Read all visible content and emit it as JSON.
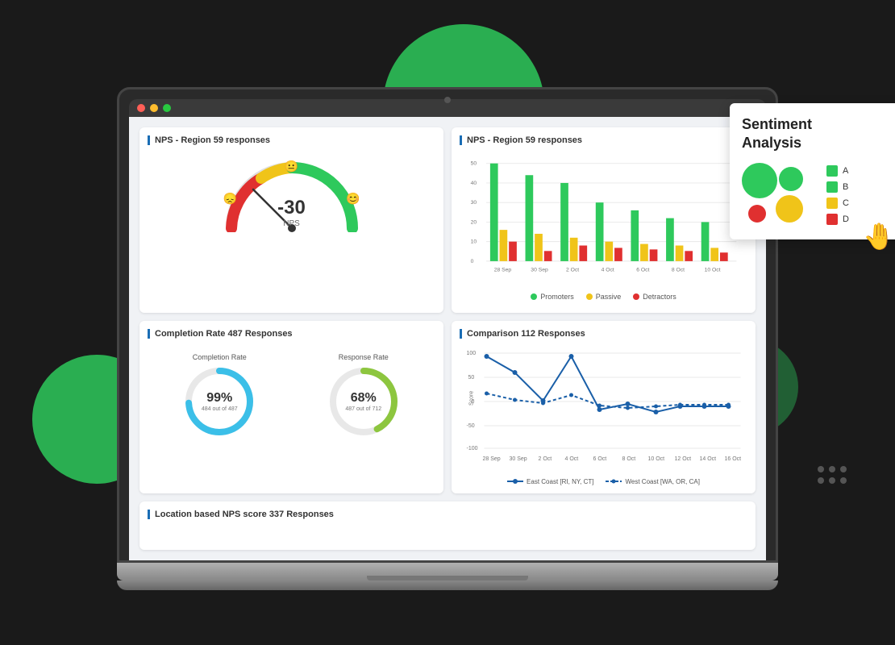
{
  "background": {
    "color": "#1a1a1a"
  },
  "sentiment_card": {
    "title": "Sentiment\nAnalysis",
    "legend": [
      {
        "label": "A",
        "color": "#2ec95c"
      },
      {
        "label": "B",
        "color": "#2ec95c"
      },
      {
        "label": "C",
        "color": "#f0c419"
      },
      {
        "label": "D",
        "color": "#e03030"
      }
    ]
  },
  "nps_gauge": {
    "card_title": "NPS - Region 59 responses",
    "value": "-30",
    "label": "NPS"
  },
  "bar_chart": {
    "card_title": "NPS - Region 59 responses",
    "legend": {
      "promoters": "Promoters",
      "passive": "Passive",
      "detractors": "Detractors"
    },
    "dates": [
      "28 Sep",
      "30 Sep",
      "2 Oct",
      "4 Oct",
      "6 Oct",
      "8 Oct",
      "10 Oct"
    ]
  },
  "completion": {
    "card_title": "Completion Rate 487 Responses",
    "completion": {
      "title": "Completion Rate",
      "percent": "99%",
      "sub": "484 out of 487",
      "color": "#3bbfe8"
    },
    "response": {
      "title": "Response Rate",
      "percent": "68%",
      "sub": "487 out of 712",
      "color": "#8dc63f"
    }
  },
  "comparison": {
    "card_title": "Comparison 112 Responses",
    "legend": {
      "east": "East Coast [RI, NY, CT]",
      "west": "West Coast [WA, OR, CA]"
    }
  },
  "location": {
    "card_title": "Location based NPS score 337 Responses"
  }
}
